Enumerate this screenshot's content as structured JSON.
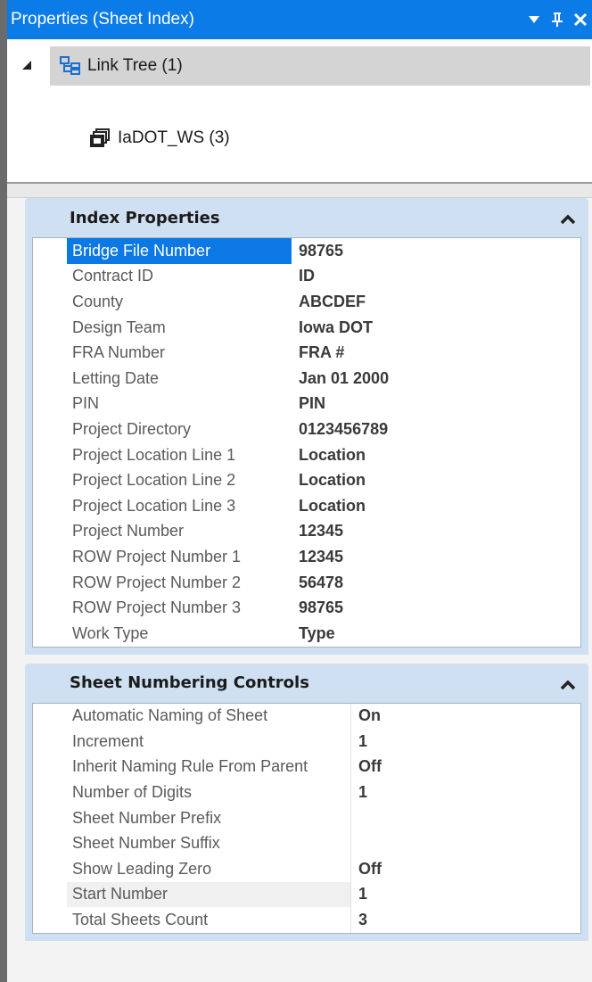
{
  "titlebar": {
    "title": "Properties (Sheet Index)",
    "btn_dropdown_icon": "dropdown-arrow-icon",
    "btn_pin_icon": "pin-icon",
    "btn_close_icon": "close-icon"
  },
  "tree": {
    "root": {
      "label": "Link Tree (1)",
      "icon": "link-tree-icon",
      "expanded": true
    },
    "children": [
      {
        "label": "IaDOT_WS (3)",
        "icon": "sheet-set-icon"
      }
    ]
  },
  "index_properties": {
    "header": "Index Properties",
    "rows": [
      {
        "name": "Bridge File Number",
        "value": "98765"
      },
      {
        "name": "Contract ID",
        "value": "ID"
      },
      {
        "name": "County",
        "value": "ABCDEF"
      },
      {
        "name": "Design Team",
        "value": "Iowa DOT"
      },
      {
        "name": "FRA Number",
        "value": "FRA #"
      },
      {
        "name": "Letting Date",
        "value": "Jan 01 2000"
      },
      {
        "name": "PIN",
        "value": "PIN"
      },
      {
        "name": "Project Directory",
        "value": "0123456789"
      },
      {
        "name": "Project Location Line 1",
        "value": "Location"
      },
      {
        "name": "Project Location Line 2",
        "value": "Location"
      },
      {
        "name": "Project Location Line 3",
        "value": "Location"
      },
      {
        "name": "Project Number",
        "value": "12345"
      },
      {
        "name": "ROW Project Number 1",
        "value": "12345"
      },
      {
        "name": "ROW Project Number 2",
        "value": "56478"
      },
      {
        "name": "ROW Project Number 3",
        "value": "98765"
      },
      {
        "name": "Work Type",
        "value": "Type"
      }
    ]
  },
  "sheet_numbering_controls": {
    "header": "Sheet Numbering Controls",
    "rows": [
      {
        "name": "Automatic Naming of Sheet",
        "value": "On"
      },
      {
        "name": "Increment",
        "value": "1"
      },
      {
        "name": "Inherit Naming Rule From Parent",
        "value": "Off"
      },
      {
        "name": "Number of Digits",
        "value": "1"
      },
      {
        "name": "Sheet Number Prefix",
        "value": ""
      },
      {
        "name": "Sheet Number Suffix",
        "value": ""
      },
      {
        "name": "Show Leading Zero",
        "value": "Off"
      },
      {
        "name": "Start Number",
        "value": "1"
      },
      {
        "name": "Total Sheets Count",
        "value": "3"
      }
    ]
  },
  "colors": {
    "titlebar": "#0b7be8",
    "section_header": "#cfe0f3",
    "selection": "#0b78e3"
  }
}
